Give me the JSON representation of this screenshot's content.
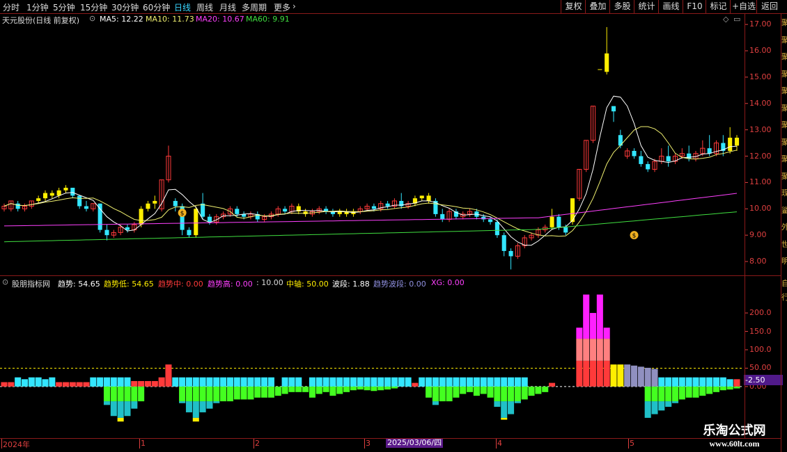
{
  "toolbar": {
    "left_items": [
      "分时",
      "1分钟",
      "5分钟",
      "15分钟",
      "30分钟",
      "60分钟",
      "日线",
      "周线",
      "月线",
      "多周期",
      "更多"
    ],
    "active_item": "日线",
    "more_arrow": "›",
    "right_items": [
      "复权",
      "叠加",
      "多股",
      "统计",
      "画线",
      "F10",
      "标记",
      "+自选",
      "返回"
    ]
  },
  "main_header": {
    "stock": "天元股份(日线 前复权)",
    "ma5_label": "MA5:",
    "ma5_value": "12.22",
    "ma10_label": "MA10:",
    "ma10_value": "11.73",
    "ma20_label": "MA20:",
    "ma20_value": "10.67",
    "ma60_label": "MA60:",
    "ma60_value": "9.91",
    "diamond_icon": "◇",
    "menu_icon": "▭"
  },
  "price_axis": [
    "17.00",
    "16.00",
    "15.00",
    "14.00",
    "13.00",
    "12.00",
    "11.00",
    "10.00",
    "9.00",
    "8.00"
  ],
  "indicator_header": {
    "name": "股朋指标网",
    "trend_label": "趋势:",
    "trend_value": "54.65",
    "trend_low_label": "趋势低:",
    "trend_low_value": "54.65",
    "trend_mid_label": "趋势中:",
    "trend_mid_value": "0.00",
    "trend_high_label": "趋势高:",
    "trend_high_value": "0.00",
    "sep_value": ": 10.00",
    "axis_label": "中轴:",
    "axis_value": "50.00",
    "wave_label": "波段:",
    "wave_value": "1.88",
    "trend_wave_label": "趋势波段:",
    "trend_wave_value": "0.00",
    "xg_label": "XG:",
    "xg_value": "0.00"
  },
  "indicator_axis": [
    "200.0",
    "150.0",
    "100.0",
    "50.00",
    "0.00"
  ],
  "indicator_current": "-2.50",
  "date_axis": {
    "labels": [
      "2024年",
      "1",
      "2",
      "3",
      "4",
      "5"
    ],
    "highlight": "2025/03/06/四"
  },
  "side_chars_top": [
    "聚",
    "聚",
    "聚",
    "聚",
    "聚",
    "聚",
    "聚",
    "聚",
    "聚",
    "聚",
    "现",
    "鲨",
    "外",
    "世",
    "明"
  ],
  "side_chars_bottom": [
    "自",
    "行"
  ],
  "watermark": {
    "title": "乐淘公式网",
    "url": "www.60lt.com"
  },
  "colors": {
    "up": "#ff3a3a",
    "down": "#33e6ff",
    "ma5": "#ffffff",
    "ma10": "#f0f070",
    "ma20": "#ff40ff",
    "ma60": "#40e040",
    "yellow": "#ffee00",
    "axis": "#e04040"
  },
  "chart_data": {
    "type": "candlestick",
    "price_range": [
      7.5,
      17.4
    ],
    "indicator_range": [
      -140,
      270
    ],
    "dashed_levels": [
      50,
      0
    ],
    "markers": [
      "money-bag-icon",
      "money-bag-icon"
    ]
  }
}
